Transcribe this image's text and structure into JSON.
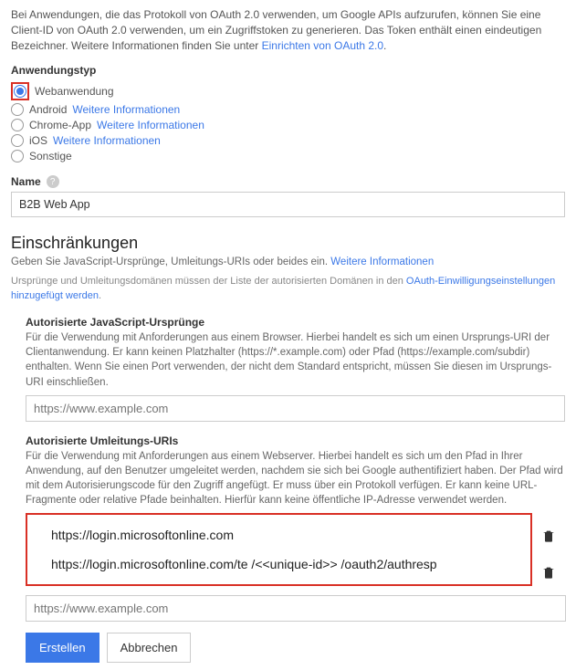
{
  "intro": {
    "text1": "Bei Anwendungen, die das Protokoll von OAuth 2.0 verwenden, um Google APIs aufzurufen, können Sie eine Client-ID von OAuth 2.0 verwenden, um ein Zugriffstoken zu generieren. Das Token enthält einen eindeutigen Bezeichner. Weitere Informationen finden Sie unter ",
    "link": "Einrichten von OAuth 2.0",
    "period": "."
  },
  "app_type": {
    "label": "Anwendungstyp",
    "options": [
      {
        "label": "Webanwendung",
        "selected": true,
        "more": null
      },
      {
        "label": "Android",
        "selected": false,
        "more": "Weitere Informationen"
      },
      {
        "label": "Chrome-App",
        "selected": false,
        "more": "Weitere Informationen"
      },
      {
        "label": "iOS",
        "selected": false,
        "more": "Weitere Informationen"
      },
      {
        "label": "Sonstige",
        "selected": false,
        "more": null
      }
    ]
  },
  "name": {
    "label": "Name",
    "value": "B2B Web App"
  },
  "restrictions": {
    "heading": "Einschränkungen",
    "sub1a": "Geben Sie JavaScript-Ursprünge, Umleitungs-URIs oder beides ein. ",
    "sub1_link": "Weitere Informationen",
    "sub2a": "Ursprünge und Umleitungsdomänen müssen der Liste der autorisierten Domänen in den ",
    "sub2_link": "OAuth-Einwilligungseinstellungen hinzugefügt werden",
    "sub2b": "."
  },
  "js_origins": {
    "title": "Autorisierte JavaScript-Ursprünge",
    "desc": "Für die Verwendung mit Anforderungen aus einem Browser. Hierbei handelt es sich um einen Ursprungs-URI der Clientanwendung. Er kann keinen Platzhalter (https://*.example.com) oder Pfad (https://example.com/subdir) enthalten. Wenn Sie einen Port verwenden, der nicht dem Standard entspricht, müssen Sie diesen im Ursprungs-URI einschließen.",
    "placeholder": "https://www.example.com"
  },
  "redirect_uris": {
    "title": "Autorisierte Umleitungs-URIs",
    "desc": "Für die Verwendung mit Anforderungen aus einem Webserver. Hierbei handelt es sich um den Pfad in Ihrer Anwendung, auf den Benutzer umgeleitet werden, nachdem sie sich bei Google authentifiziert haben. Der Pfad wird mit dem Autorisierungscode für den Zugriff angefügt. Er muss über ein Protokoll verfügen. Er kann keine URL-Fragmente oder relative Pfade beinhalten. Hierfür kann keine öffentliche IP-Adresse verwendet werden.",
    "items": [
      "https://login.microsoftonline.com",
      "https://login.microsoftonline.com/te /<<unique-id>> /oauth2/authresp"
    ],
    "placeholder": "https://www.example.com"
  },
  "buttons": {
    "create": "Erstellen",
    "cancel": "Abbrechen"
  }
}
